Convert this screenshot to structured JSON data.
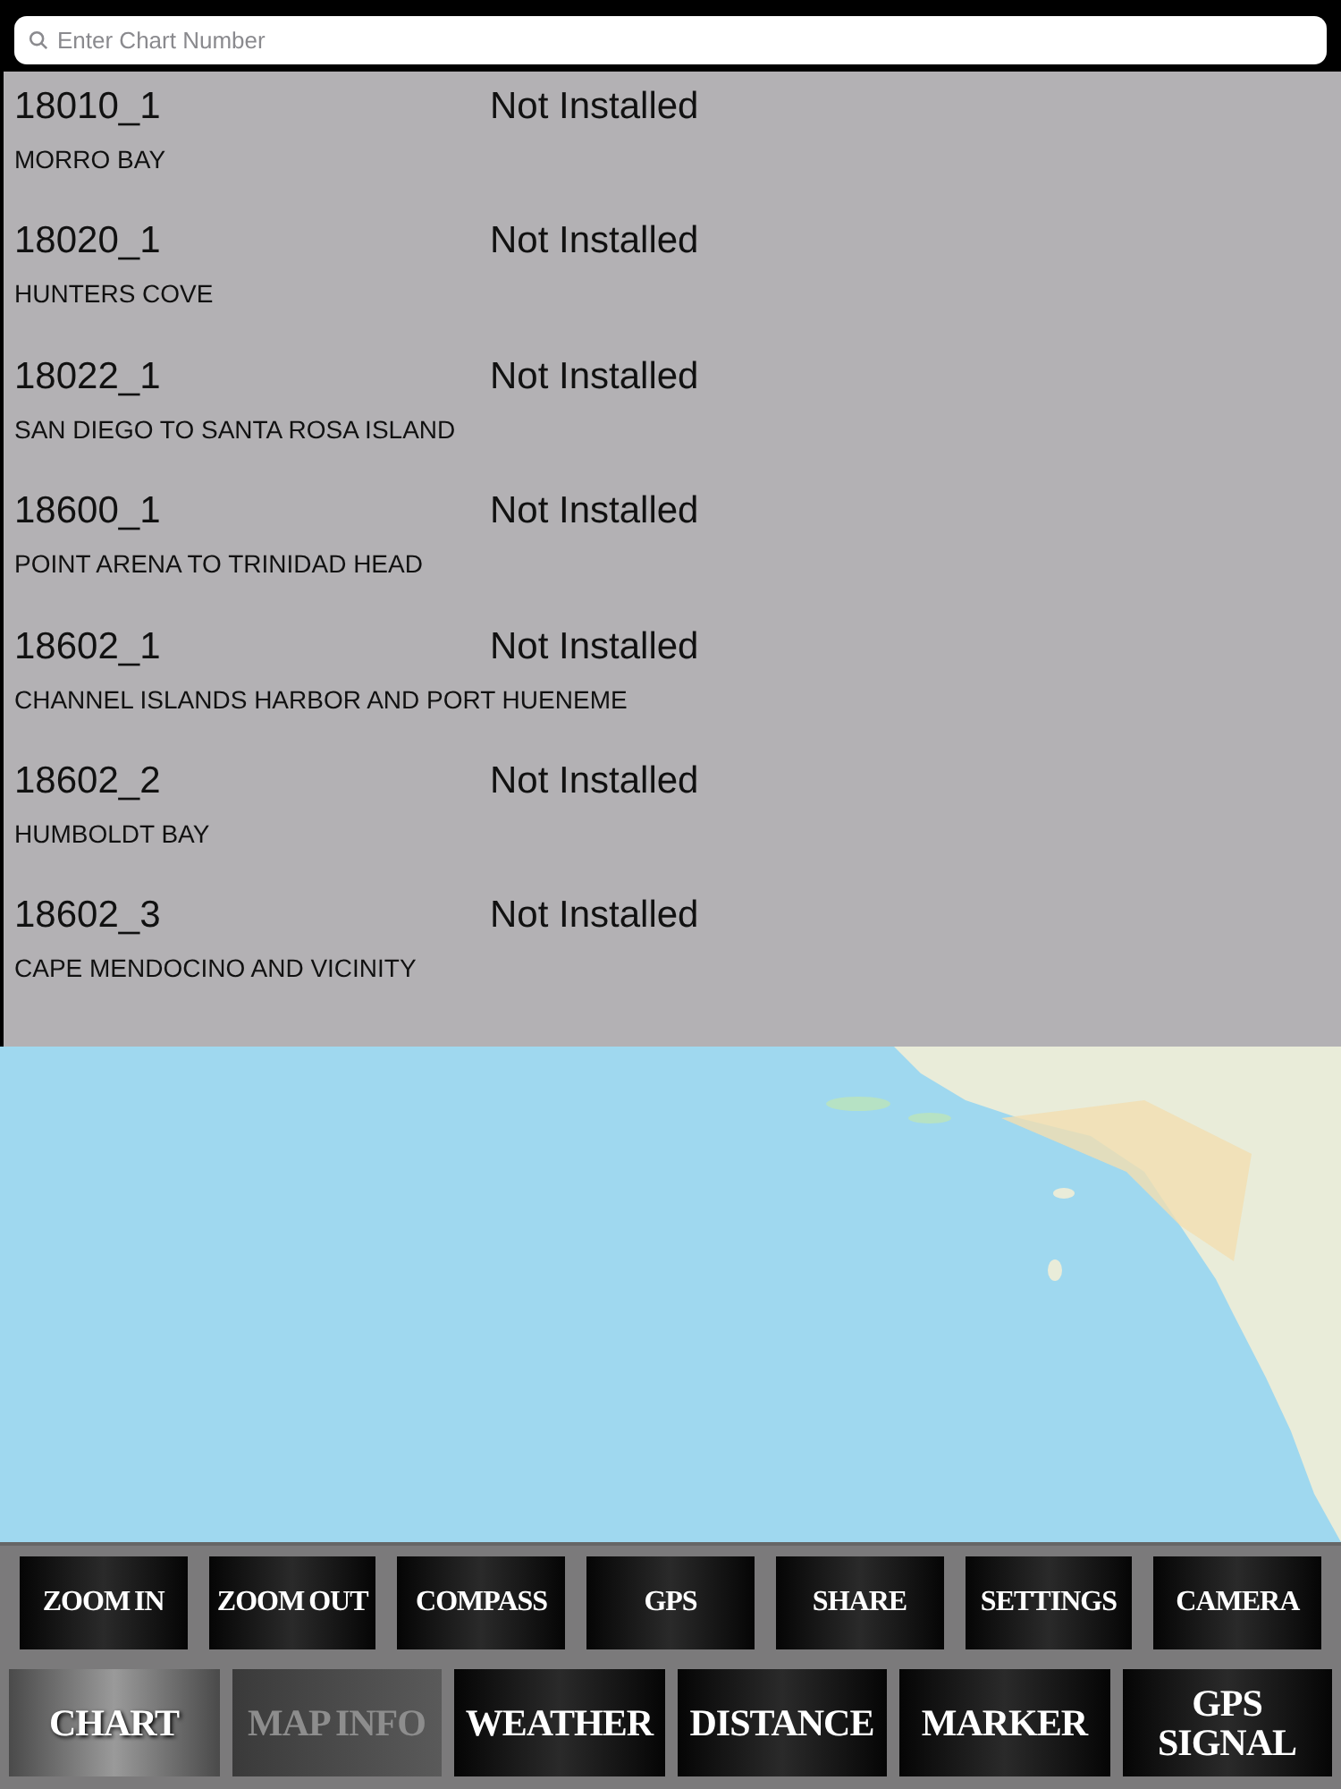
{
  "search": {
    "placeholder": "Enter Chart Number"
  },
  "charts": [
    {
      "number": "18010_1",
      "status": "Not Installed",
      "name": "MORRO BAY"
    },
    {
      "number": "18020_1",
      "status": "Not Installed",
      "name": "HUNTERS COVE"
    },
    {
      "number": "18022_1",
      "status": "Not Installed",
      "name": "SAN DIEGO TO SANTA ROSA ISLAND"
    },
    {
      "number": "18600_1",
      "status": "Not Installed",
      "name": "POINT ARENA TO TRINIDAD HEAD"
    },
    {
      "number": "18602_1",
      "status": "Not Installed",
      "name": "CHANNEL ISLANDS HARBOR AND PORT HUENEME"
    },
    {
      "number": "18602_2",
      "status": "Not Installed",
      "name": "HUMBOLDT BAY"
    },
    {
      "number": "18602_3",
      "status": "Not Installed",
      "name": "CAPE MENDOCINO AND VICINITY"
    }
  ],
  "toolbar_top": [
    {
      "label": "ZOOM IN"
    },
    {
      "label": "ZOOM OUT"
    },
    {
      "label": "COMPASS"
    },
    {
      "label": "GPS"
    },
    {
      "label": "SHARE"
    },
    {
      "label": "SETTINGS"
    },
    {
      "label": "CAMERA"
    }
  ],
  "toolbar_bottom": [
    {
      "label": "CHART",
      "selected": true,
      "disabled": false
    },
    {
      "label": "MAP INFO",
      "selected": false,
      "disabled": true
    },
    {
      "label": "WEATHER",
      "selected": false,
      "disabled": false
    },
    {
      "label": "DISTANCE",
      "selected": false,
      "disabled": false
    },
    {
      "label": "MARKER",
      "selected": false,
      "disabled": false
    },
    {
      "label": "GPS SIGNAL",
      "selected": false,
      "disabled": false
    }
  ]
}
